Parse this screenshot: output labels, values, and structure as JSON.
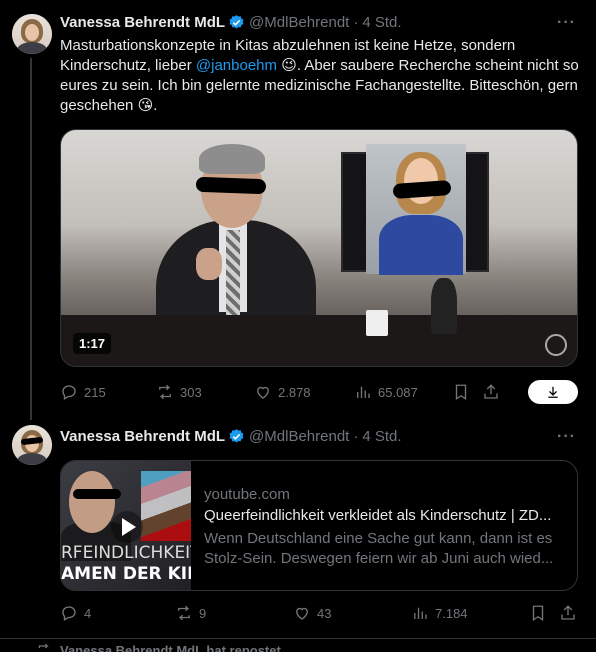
{
  "tweet1": {
    "name": "Vanessa Behrendt MdL",
    "handle": "@MdlBehrendt",
    "dot": "·",
    "time": "4 Std.",
    "more": "···",
    "text_part1": "Masturbationskonzepte in Kitas abzulehnen ist keine Hetze, sondern Kinderschutz, lieber ",
    "mention": "@janboehm",
    "emoji_wink": "😉",
    "text_part2": ". Aber saubere Recherche scheint nicht so eures zu sein. Ich bin gelernte medizinische Fachangestellte. Bitteschön, gern geschehen ",
    "emoji_kiss": "😘",
    "text_part3": ".",
    "video_duration": "1:17",
    "replies": "215",
    "reposts": "303",
    "likes": "2.878",
    "views": "65.087"
  },
  "tweet2": {
    "name": "Vanessa Behrendt MdL",
    "handle": "@MdlBehrendt",
    "dot": "·",
    "time": "4 Std.",
    "more": "···",
    "card": {
      "thumb_caption_1": "RFEINDLICHKEIT",
      "thumb_caption_2": "AMEN DER KIN",
      "domain": "youtube.com",
      "title": "Queerfeindlichkeit verkleidet als Kinderschutz | ZD...",
      "description": "Wenn Deutschland eine Sache gut kann, dann ist es Stolz-Sein. Deswegen feiern wir ab Juni auch wied..."
    },
    "replies": "4",
    "reposts": "9",
    "likes": "43",
    "views": "7.184"
  },
  "repost_notice": "Vanessa Behrendt MdL hat repostet",
  "colors": {
    "accent": "#1d9bf0",
    "muted": "#71767b",
    "text": "#e7e9ea",
    "background": "#000000",
    "border": "#2f3336"
  },
  "icons": [
    "reply-icon",
    "repost-icon",
    "like-icon",
    "views-icon",
    "bookmark-icon",
    "share-icon",
    "download-icon",
    "verified-badge-icon",
    "more-icon"
  ]
}
